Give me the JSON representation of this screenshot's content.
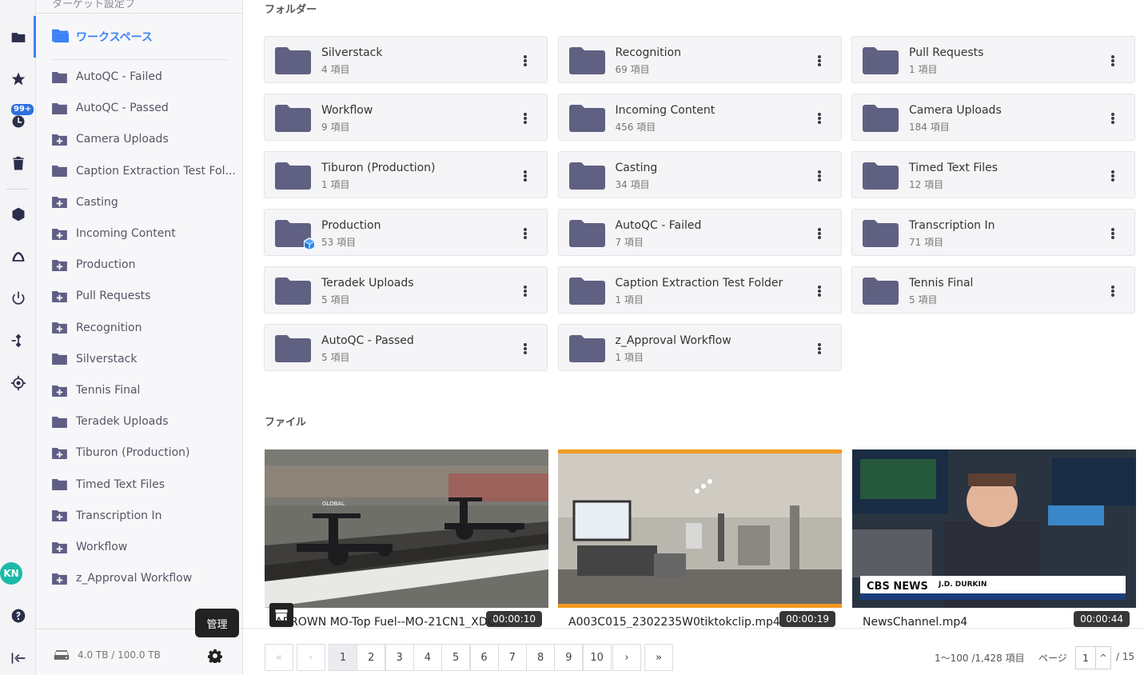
{
  "sidebar": {
    "top_cut_label": "ターゲット設定フ",
    "workspace_label": "ワークスペース",
    "items": [
      {
        "label": "AutoQC - Failed",
        "icon": "folder-icon"
      },
      {
        "label": "AutoQC - Passed",
        "icon": "folder-icon"
      },
      {
        "label": "Camera Uploads",
        "icon": "folder-plus-icon"
      },
      {
        "label": "Caption Extraction Test Fol...",
        "icon": "folder-icon"
      },
      {
        "label": "Casting",
        "icon": "folder-plus-icon"
      },
      {
        "label": "Incoming Content",
        "icon": "folder-plus-icon"
      },
      {
        "label": "Production",
        "icon": "folder-plus-icon"
      },
      {
        "label": "Pull Requests",
        "icon": "folder-plus-icon"
      },
      {
        "label": "Recognition",
        "icon": "folder-plus-icon"
      },
      {
        "label": "Silverstack",
        "icon": "folder-icon"
      },
      {
        "label": "Tennis Final",
        "icon": "folder-plus-icon"
      },
      {
        "label": "Teradek Uploads",
        "icon": "folder-icon"
      },
      {
        "label": "Tiburon (Production)",
        "icon": "folder-plus-icon"
      },
      {
        "label": "Timed Text Files",
        "icon": "folder-icon"
      },
      {
        "label": "Transcription In",
        "icon": "folder-plus-icon"
      },
      {
        "label": "Workflow",
        "icon": "folder-plus-icon"
      },
      {
        "label": "z_Approval Workflow",
        "icon": "folder-plus-icon"
      }
    ],
    "storage": "4.0 TB / 100.0 TB",
    "tooltip": "管理"
  },
  "rail": {
    "badge": "99+",
    "avatar_initials": "KN"
  },
  "main": {
    "folders_heading": "フォルダー",
    "files_heading": "ファイル",
    "folders": [
      {
        "name": "Silverstack",
        "count": "4 項目"
      },
      {
        "name": "Recognition",
        "count": "69 項目"
      },
      {
        "name": "Pull Requests",
        "count": "1 項目"
      },
      {
        "name": "Workflow",
        "count": "9 項目"
      },
      {
        "name": "Incoming Content",
        "count": "456 項目"
      },
      {
        "name": "Camera Uploads",
        "count": "184 項目"
      },
      {
        "name": "Tiburon (Production)",
        "count": "1 項目"
      },
      {
        "name": "Casting",
        "count": "34 項目"
      },
      {
        "name": "Timed Text Files",
        "count": "12 項目"
      },
      {
        "name": "Production",
        "count": "53 項目"
      },
      {
        "name": "AutoQC - Failed",
        "count": "7 項目"
      },
      {
        "name": "Transcription In",
        "count": "71 項目"
      },
      {
        "name": "Teradek Uploads",
        "count": "5 項目"
      },
      {
        "name": "Caption Extraction Test Folder",
        "count": "1 項目"
      },
      {
        "name": "Tennis Final",
        "count": "5 項目"
      },
      {
        "name": "AutoQC - Passed",
        "count": "5 項目"
      },
      {
        "name": "z_Approval Workflow",
        "count": "1 項目"
      }
    ],
    "files": [
      {
        "name": "ABROWN MO-Top Fuel--MO-21CN1_XDC...",
        "duration": "00:00:10"
      },
      {
        "name": "A003C015_2302235W0tiktokclip.mp4",
        "duration": "00:00:19"
      },
      {
        "name": "NewsChannel.mp4",
        "duration": "00:00:44"
      }
    ],
    "thumb_text": {
      "news_logo": "CBS NEWS",
      "news_name": "J.D. DURKIN",
      "dragster_banner": "GLOBAL"
    }
  },
  "pager": {
    "first": "«",
    "prev": "‹",
    "pages": [
      "1",
      "2",
      "3",
      "4",
      "5",
      "6",
      "7",
      "8",
      "9",
      "10"
    ],
    "next": "›",
    "last": "»",
    "range_info": "1〜100 /1,428 項目",
    "page_label": "ページ",
    "page_input": "1",
    "page_up": "^",
    "page_total": "/ 15"
  }
}
